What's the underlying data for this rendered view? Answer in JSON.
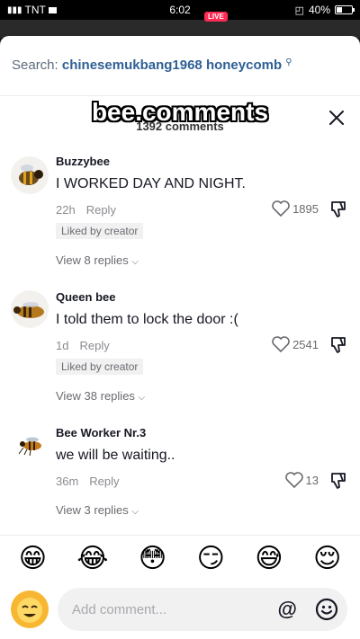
{
  "status_bar": {
    "carrier": "TNT",
    "time": "6:02",
    "battery": "40%",
    "battery_level": 0.4
  },
  "live_badge": "LIVE",
  "search": {
    "label": "Search:",
    "query": "chinesemukbang1968 honeycomb"
  },
  "header": {
    "count": "1392 comments",
    "overlay_text": "bee.comments"
  },
  "comments": [
    {
      "username": "Buzzybee",
      "text": "I WORKED DAY AND NIGHT.",
      "time": "22h",
      "reply": "Reply",
      "liked_by": "Liked by creator",
      "likes": "1895",
      "view_replies": "View 8 replies"
    },
    {
      "username": "Queen bee",
      "text": "I told them to lock the door :(",
      "time": "1d",
      "reply": "Reply",
      "liked_by": "Liked by creator",
      "likes": "2541",
      "view_replies": "View 38 replies"
    },
    {
      "username": "Bee Worker Nr.3",
      "text": "we will be waiting..",
      "time": "36m",
      "reply": "Reply",
      "likes": "13",
      "view_replies": "View 3 replies"
    }
  ],
  "emoji_bar": [
    "😁",
    "😂",
    "😳",
    "😏",
    "😅",
    "😌"
  ],
  "input": {
    "placeholder": "Add comment...",
    "at": "@"
  },
  "colors": {
    "accent": "#2f5f95",
    "live": "#ff2b55",
    "muted": "#8a8b91"
  }
}
